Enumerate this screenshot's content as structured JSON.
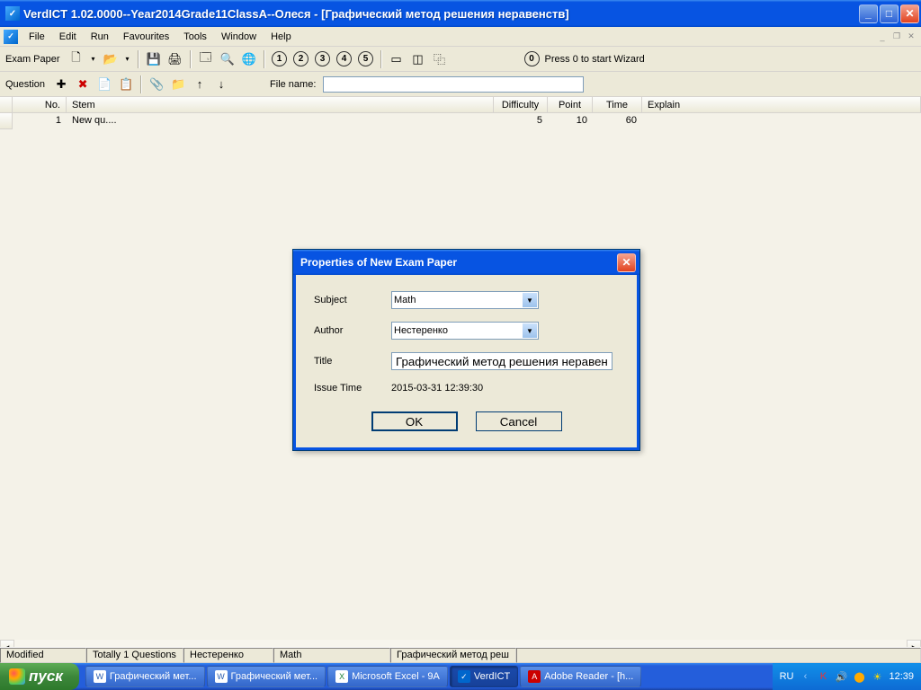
{
  "window": {
    "title": "VerdICT 1.02.0000--Year2014Grade11ClassA--Олеся - [Графический метод решения неравенств]"
  },
  "menu": {
    "items": [
      "File",
      "Edit",
      "Run",
      "Favourites",
      "Tools",
      "Window",
      "Help"
    ]
  },
  "toolbar1": {
    "label": "Exam Paper",
    "wizard": "Press 0 to start Wizard"
  },
  "toolbar2": {
    "label": "Question",
    "filename_label": "File name:",
    "filename_value": ""
  },
  "table": {
    "headers": {
      "no": "No.",
      "stem": "Stem",
      "difficulty": "Difficulty",
      "point": "Point",
      "time": "Time",
      "explain": "Explain"
    },
    "rows": [
      {
        "no": "1",
        "stem": "New qu....",
        "difficulty": "5",
        "point": "10",
        "time": "60",
        "explain": ""
      }
    ]
  },
  "statusbar": {
    "modified": "Modified",
    "total": "Totally 1 Questions",
    "author": "Нестеренко",
    "subject": "Math",
    "title": "Графический метод реш"
  },
  "dialog": {
    "title": "Properties of New Exam Paper",
    "labels": {
      "subject": "Subject",
      "author": "Author",
      "title": "Title",
      "issue": "Issue Time"
    },
    "values": {
      "subject": "Math",
      "author": "Нестеренко",
      "title": "Графический метод решения неравенств",
      "issue": "2015-03-31 12:39:30"
    },
    "buttons": {
      "ok": "OK",
      "cancel": "Cancel"
    }
  },
  "taskbar": {
    "start": "пуск",
    "items": [
      {
        "label": "Графический мет...",
        "icon": "W"
      },
      {
        "label": "Графический мет...",
        "icon": "W"
      },
      {
        "label": "Microsoft Excel - 9A",
        "icon": "X"
      },
      {
        "label": "VerdICT",
        "icon": "V"
      },
      {
        "label": "Adobe Reader - [h...",
        "icon": "A"
      }
    ],
    "lang": "RU",
    "clock": "12:39"
  }
}
